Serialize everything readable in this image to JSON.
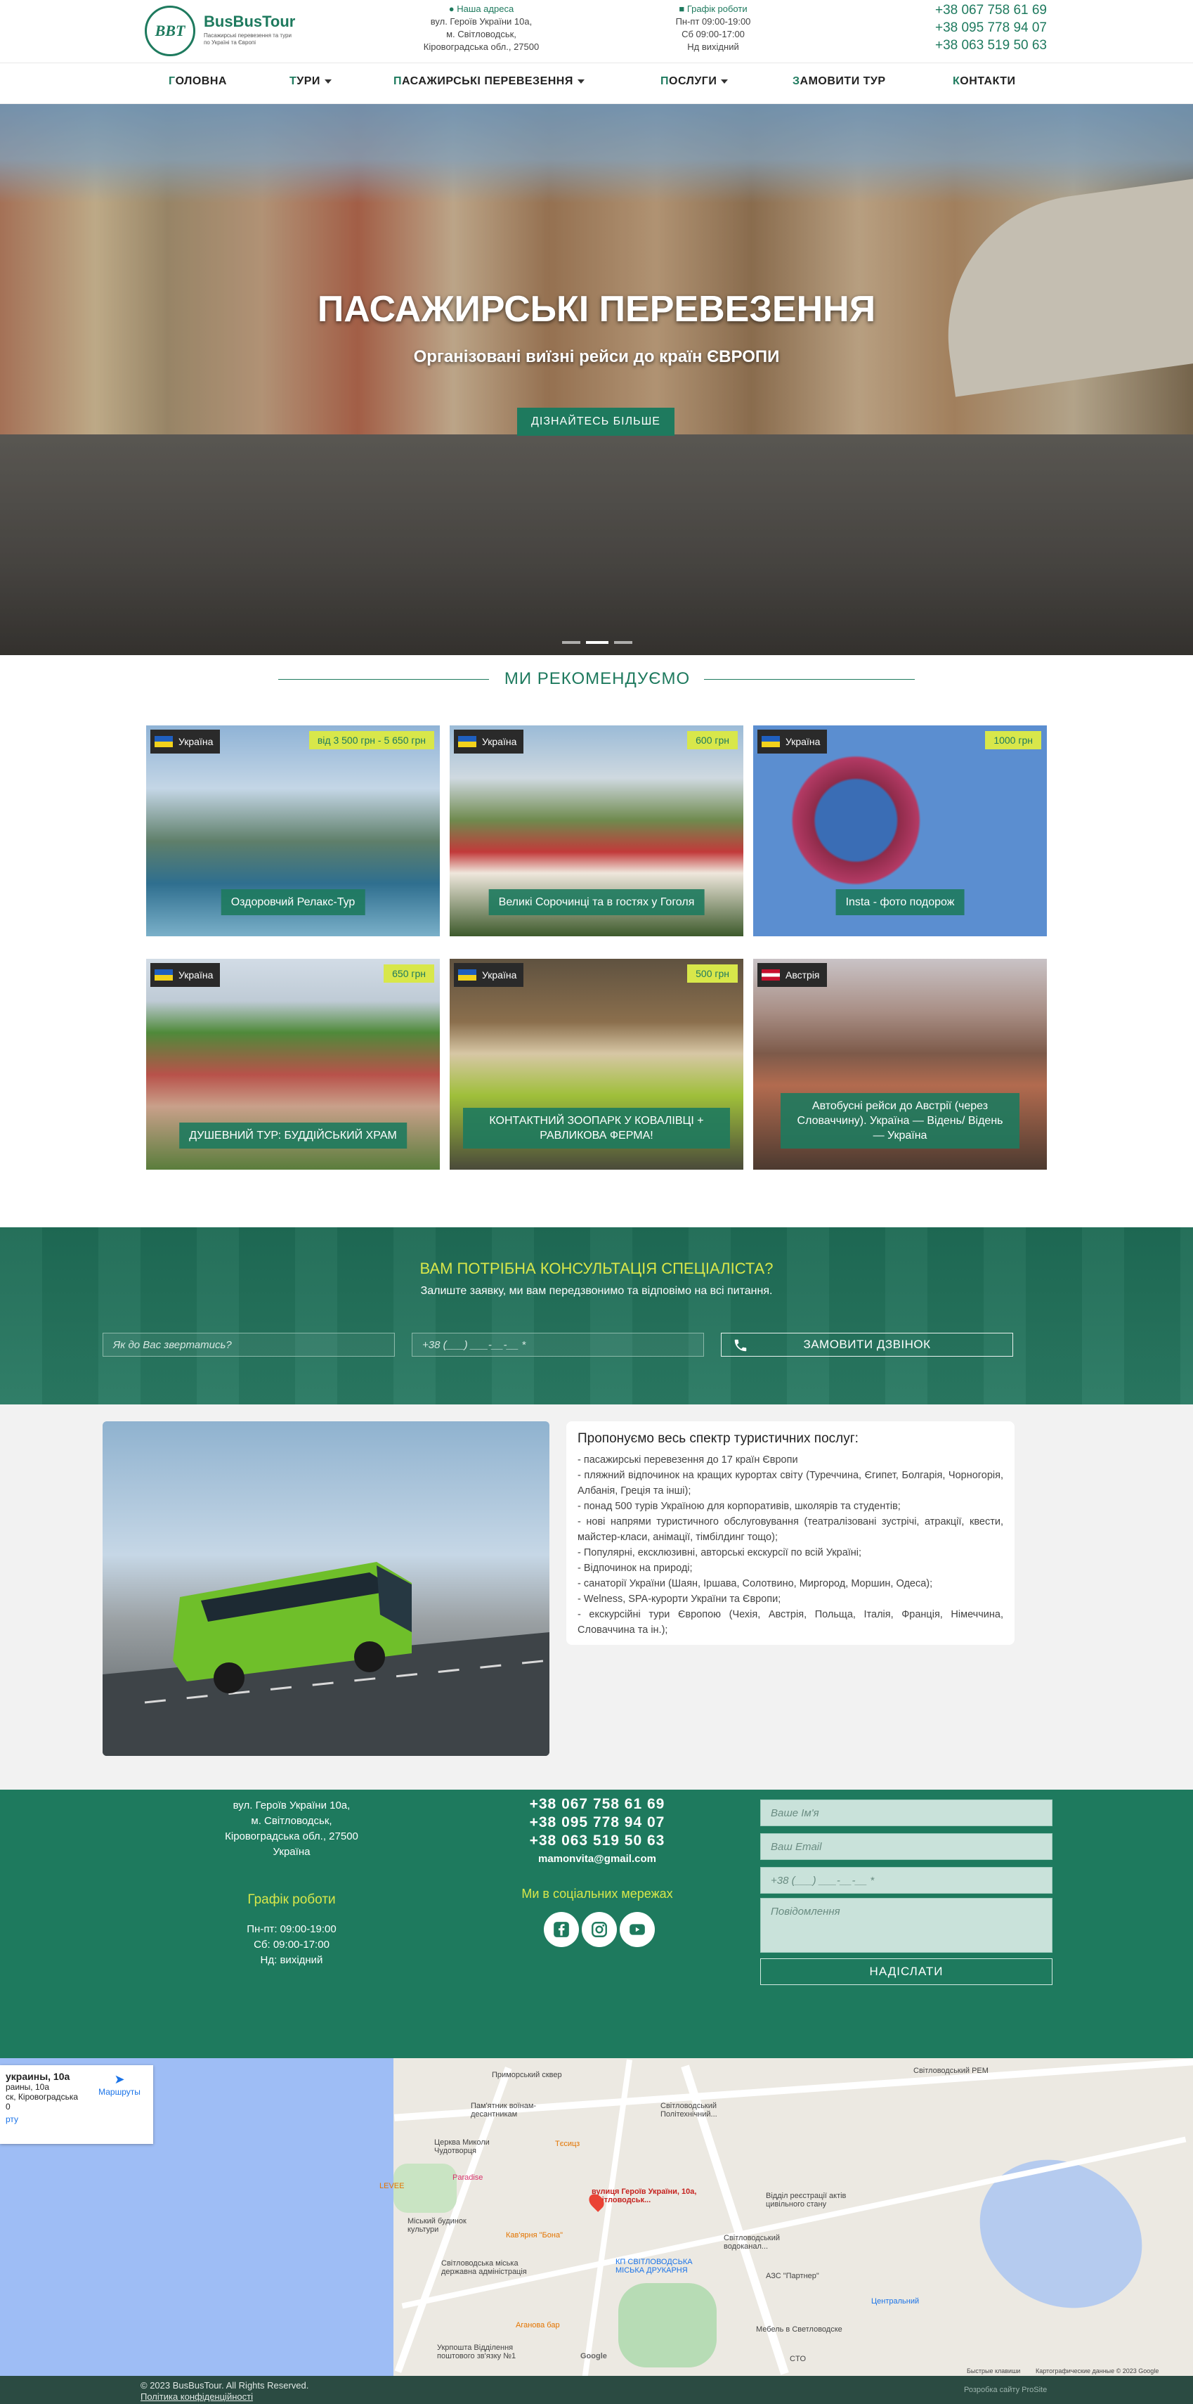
{
  "header": {
    "brand": "BusBusTour",
    "logo_text": "BBT",
    "slogan": "Пасажирські перевезення та тури по Україні та Європі",
    "address_title": "Наша адреса",
    "address_lines": [
      "вул. Героїв України 10а,",
      "м. Світловодськ,",
      "Кіровоградська обл., 27500"
    ],
    "schedule_title": "Графік роботи",
    "schedule_lines": [
      "Пн-пт 09:00-19:00",
      "Сб 09:00-17:00",
      "Нд вихідний"
    ],
    "phones": [
      "+38 067 758 61 69",
      "+38 095 778 94 07",
      "+38 063 519 50 63"
    ]
  },
  "nav": {
    "items": [
      {
        "first": "Г",
        "rest": "оловна"
      },
      {
        "first": "Т",
        "rest": "ури"
      },
      {
        "first": "П",
        "rest": "асажирські перевезення"
      },
      {
        "first": "П",
        "rest": "ослуги"
      },
      {
        "first": "З",
        "rest": "амовити тур"
      },
      {
        "first": "К",
        "rest": "онтакти"
      }
    ]
  },
  "hero": {
    "title": "ПАСАЖИРСЬКІ ПЕРЕВЕЗЕННЯ",
    "subtitle": "Організовані виїзні рейси до країн ЄВРОПИ",
    "button": "ДІЗНАЙТЕСЬ БІЛЬШЕ"
  },
  "recommend": {
    "title": "МИ РЕКОМЕНДУЄМО",
    "cards": [
      {
        "country": "Україна",
        "price": "від 3 500 грн - 5 650 грн",
        "label": "Оздоровчий Релакс-Тур"
      },
      {
        "country": "Україна",
        "price": "600 грн",
        "label": "Великі Сорочинці та в гостях у Гоголя"
      },
      {
        "country": "Україна",
        "price": "1000 грн",
        "label": "Insta - фото подорож"
      },
      {
        "country": "Україна",
        "price": "650 грн",
        "label": "ДУШЕВНИЙ ТУР: БУДДІЙСЬКИЙ ХРАМ"
      },
      {
        "country": "Україна",
        "price": "500 грн",
        "label": "КОНТАКТНИЙ ЗООПАРК у КОВАЛІВЦІ + РАВЛИКОВА ФЕРМА!"
      },
      {
        "country": "Австрія",
        "price": "",
        "label": "Автобусні рейси до Австрії (через Словаччину). Україна — Відень/ Відень — Україна"
      }
    ]
  },
  "consult": {
    "title": "ВАМ ПОТРІБНА КОНСУЛЬТАЦІЯ СПЕЦІАЛІСТА?",
    "subtitle": "Залиште заявку, ми вам передзвонимо та відповімо на всі питання.",
    "name_placeholder": "Як до Вас звертатись?",
    "phone_placeholder": "+38 (___) ___-__-__ *",
    "button": "ЗАМОВИТИ ДЗВІНОК"
  },
  "services": {
    "title": "Пропонуємо весь спектр туристичних послуг:",
    "items": [
      "- пасажирські перевезення до 17 країн Європи",
      "- пляжний відпочинок на кращих курортах світу (Туреччина, Єгипет, Болгарія, Чорногорія, Албанія, Греція та інші);",
      "- понад 500 турів Україною для корпоративів, школярів та студентів;",
      "- нові напрями туристичного обслуговування (театралізовані зустрічі, атракції, квести, майстер-класи, анімації, тімбілдинг тощо);",
      "- Популярні, ексклюзивні, авторські екскурсії по всій Україні;",
      "- Відпочинок на природі;",
      "- санаторії України (Шаян, Іршава, Солотвино, Миргород, Моршин, Одеса);",
      "- Welness, SPA-курорти України та Європи;",
      "- екскурсійні тури Європою (Чехія, Австрія, Польща, Італія, Франція, Німеччина, Словаччина та ін.);"
    ]
  },
  "footer": {
    "address_lines": [
      "вул. Героїв України 10а,",
      "м. Світловодськ,",
      "Кіровоградська обл., 27500",
      "Україна"
    ],
    "schedule_title": "Графік роботи",
    "schedule_lines": [
      "Пн-пт: 09:00-19:00",
      "Сб: 09:00-17:00",
      "Нд: вихідний"
    ],
    "phones": [
      "+38 067 758 61 69",
      "+38 095 778 94 07",
      "+38 063 519 50 63"
    ],
    "email": "mamonvita@gmail.com",
    "social_title": "Ми в соціальних мережах",
    "form": {
      "name": "Ваше Ім'я",
      "email": "Ваш Email",
      "phone": "+38 (___) ___-__-__ *",
      "message": "Повідомлення",
      "button": "НАДІСЛАТИ"
    }
  },
  "map": {
    "card_title": "украины, 10а",
    "card_lines": [
      "раины, 10а",
      "ск, Кіровоградська",
      "0"
    ],
    "card_link": "рту",
    "routes": "Маршруты",
    "labels": [
      "Приморський сквер",
      "Пам'ятник воїнам-десантникам",
      "Світловодський Політехнічний...",
      "Церква Миколи Чудотворця",
      "Тєсицз",
      "Paradise",
      "LEVEE",
      "вулиця Героїв України, 10а, Світловодськ...",
      "Відділ реєстрації актів цивільного стану",
      "Міський будинок культури",
      "Кав'ярня \"Бона\"",
      "Світловодський водоканал...",
      "Світловодська міська державна адміністрація",
      "КП СВІТЛОВОДСЬКА МІСЬКА ДРУКАРНЯ",
      "АЗС \"Партнер\"",
      "Центральний",
      "Аганова бар",
      "Укрпошта Відділення поштового зв'язку №1",
      "Мебель в Светловодске",
      "Google",
      "Світловодський РЕМ",
      "CTO",
      "Быстрые клавиши",
      "Картографические данные © 2023 Google"
    ]
  },
  "bottom": {
    "copyright": "© 2023 BusBusTour. All Rights Reserved.",
    "privacy": "Політика конфіденційності",
    "developer": "Розробка сайту ProSite"
  }
}
